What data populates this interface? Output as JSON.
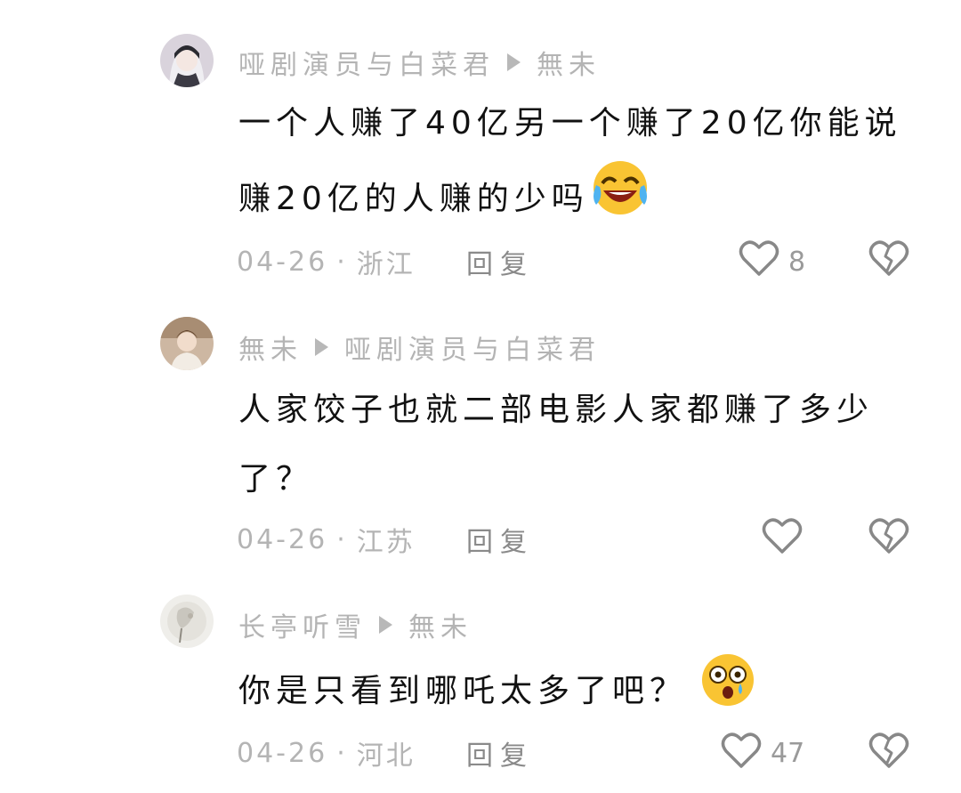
{
  "comments": [
    {
      "author": "哑剧演员与白菜君",
      "reply_to": "無未",
      "text": "一个人赚了40亿另一个赚了20亿你能说赚20亿的人赚的少吗",
      "emoji_icon": "laughing-crying-face-icon",
      "date": "04-26",
      "location": "浙江",
      "reply_label": "回复",
      "likes": "8"
    },
    {
      "author": "無未",
      "reply_to": "哑剧演员与白菜君",
      "text": "人家饺子也就二部电影人家都赚了多少了？",
      "date": "04-26",
      "location": "江苏",
      "reply_label": "回复",
      "likes": ""
    },
    {
      "author": "长亭听雪",
      "reply_to": "無未",
      "text": "你是只看到哪吒太多了吧？",
      "emoji_icon": "shocked-tearful-face-icon",
      "date": "04-26",
      "location": "河北",
      "reply_label": "回复",
      "likes": "47"
    }
  ],
  "separator": "·"
}
